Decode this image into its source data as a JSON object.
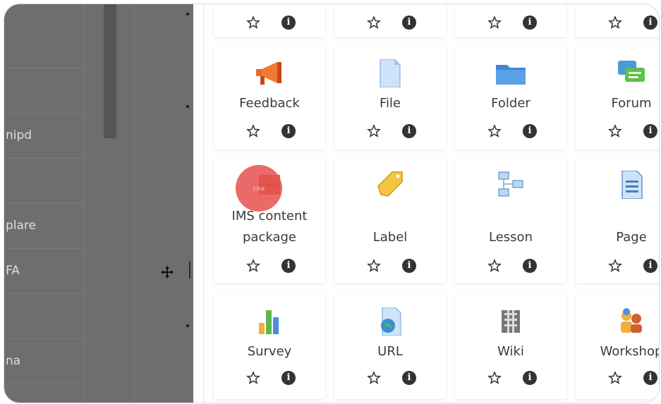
{
  "background": {
    "rows": [
      "",
      "",
      "nipd",
      "",
      "plare",
      "FA",
      "",
      "na",
      ""
    ]
  },
  "modules": [
    {
      "name": "",
      "icon": "unknown-icon"
    },
    {
      "name": "",
      "icon": "unknown-icon"
    },
    {
      "name": "",
      "icon": "unknown-icon"
    },
    {
      "name": "",
      "icon": "unknown-icon"
    },
    {
      "name": "Feedback",
      "icon": "megaphone-icon"
    },
    {
      "name": "File",
      "icon": "file-icon"
    },
    {
      "name": "Folder",
      "icon": "folder-icon"
    },
    {
      "name": "Forum",
      "icon": "speech-bubbles-icon"
    },
    {
      "name": "IMS content",
      "name2": "package",
      "icon": "package-icon"
    },
    {
      "name": "Label",
      "icon": "tag-icon"
    },
    {
      "name": "Lesson",
      "icon": "flowchart-icon"
    },
    {
      "name": "Page",
      "icon": "page-icon"
    },
    {
      "name": "Survey",
      "icon": "bar-chart-icon"
    },
    {
      "name": "URL",
      "icon": "globe-page-icon"
    },
    {
      "name": "Wiki",
      "icon": "wiki-icon"
    },
    {
      "name": "Workshop",
      "icon": "people-icon"
    }
  ],
  "click_indicator": {
    "text": "Click"
  },
  "colors": {
    "accent": "#e65050",
    "dim": "#6e6e6e"
  }
}
